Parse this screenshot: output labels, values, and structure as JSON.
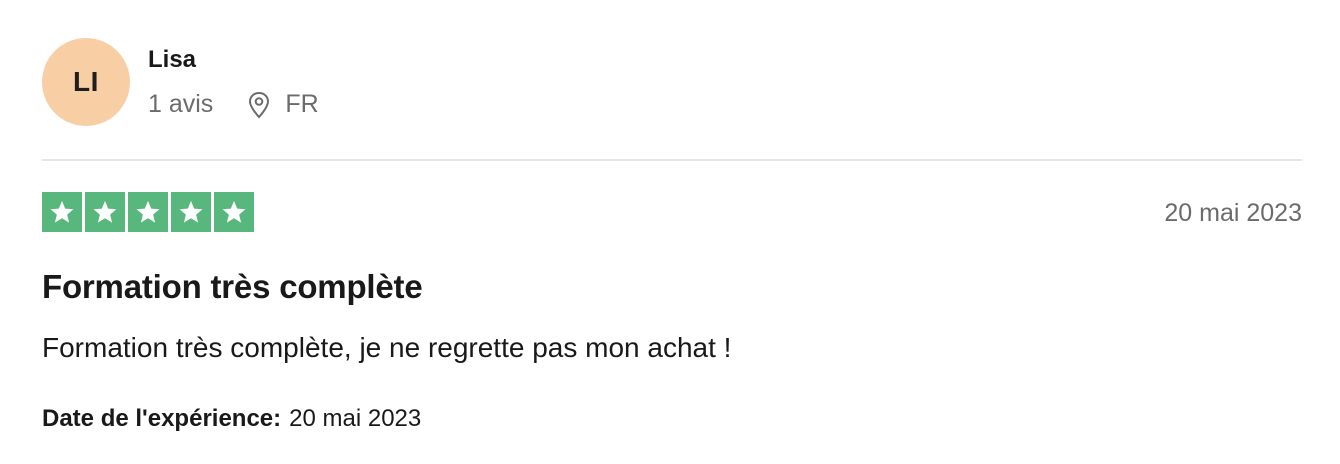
{
  "reviewer": {
    "initials": "LI",
    "name": "Lisa",
    "review_count": "1 avis",
    "country": "FR",
    "avatar_color": "#f8cfa4",
    "location_icon": "map-pin-icon"
  },
  "review": {
    "rating": 5,
    "rating_max": 5,
    "star_color": "#57b77d",
    "date": "20 mai 2023",
    "title": "Formation très complète",
    "text": "Formation très complète, je ne regrette pas mon achat !",
    "experience_label": "Date de l'expérience:",
    "experience_date": "20 mai 2023"
  }
}
